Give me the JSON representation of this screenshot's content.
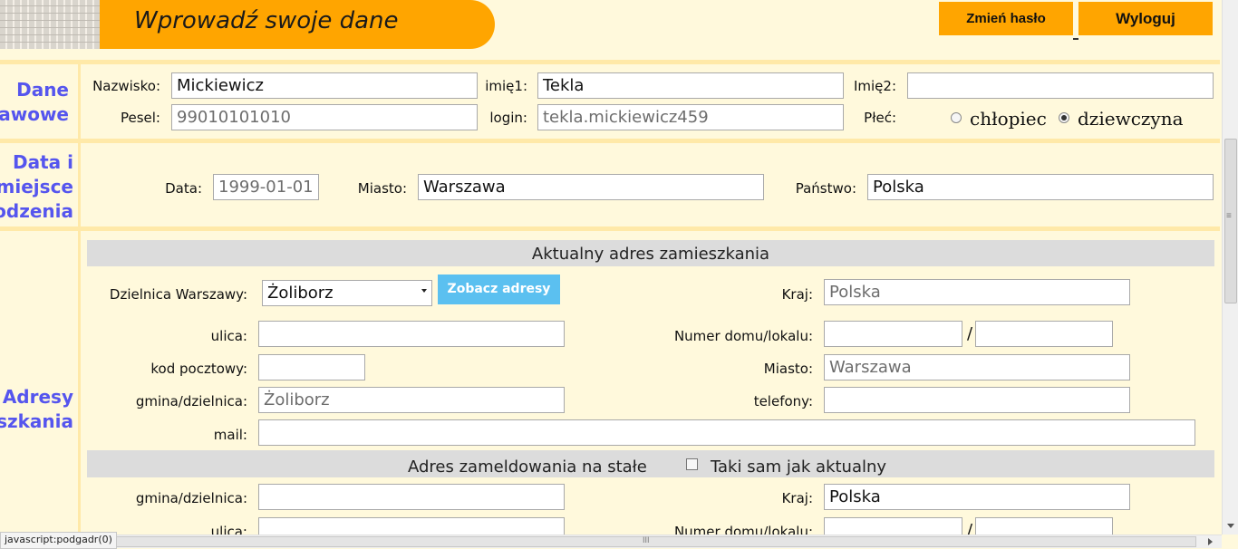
{
  "header": {
    "title": "Wprowadź swoje dane",
    "change_password": "Zmień hasło",
    "logout": "Wyloguj"
  },
  "sections": {
    "basic": "Dane\nawowe",
    "birth": "Data i\nmiejsce\nodzenia",
    "address": "Adresy\nszkania"
  },
  "basic": {
    "nazwisko_label": "Nazwisko:",
    "nazwisko_value": "Mickiewicz",
    "imie1_label": "imię1:",
    "imie1_value": "Tekla",
    "imie2_label": "Imię2:",
    "imie2_value": "",
    "pesel_label": "Pesel:",
    "pesel_value": "99010101010",
    "login_label": "login:",
    "login_value": "tekla.mickiewicz459",
    "plec_label": "Płeć:",
    "gender_options": [
      "chłopiec",
      "dziewczyna"
    ],
    "gender_selected": "dziewczyna"
  },
  "birth": {
    "data_label": "Data:",
    "data_value": "1999-01-01",
    "miasto_label": "Miasto:",
    "miasto_value": "Warszawa",
    "panstwo_label": "Państwo:",
    "panstwo_value": "Polska"
  },
  "current_address": {
    "header": "Aktualny adres zamieszkania",
    "dzielnica_label": "Dzielnica Warszawy:",
    "dzielnica_value": "Żoliborz",
    "zobacz_button": "Zobacz adresy",
    "kraj_label": "Kraj:",
    "kraj_value": "Polska",
    "ulica_label": "ulica:",
    "ulica_value": "",
    "numer_label": "Numer domu/lokalu:",
    "numer_value": "",
    "lokal_value": "",
    "slash": "/",
    "kod_label": "kod pocztowy:",
    "kod_value": "",
    "miasto_label": "Miasto:",
    "miasto_value": "Warszawa",
    "gmina_label": "gmina/dzielnica:",
    "gmina_value": "Żoliborz",
    "telefony_label": "telefony:",
    "telefony_value": "",
    "mail_label": "mail:",
    "mail_value": ""
  },
  "registered_address": {
    "header": "Adres zameldowania na stałe",
    "same_label": "Taki sam jak aktualny",
    "same_checked": false,
    "gmina_label": "gmina/dzielnica:",
    "gmina_value": "",
    "kraj_label": "Kraj:",
    "kraj_value": "Polska",
    "ulica_label": "ulica:",
    "numer_label": "Numer domu/lokalu:",
    "slash": "/"
  },
  "status_bar": {
    "text": "javascript:podgadr(0)"
  },
  "scrollbar": {
    "h_grip": "III",
    "v_grip": "≡"
  },
  "colors": {
    "background": "#fff9dc",
    "accent_orange": "#ffa500",
    "section_label": "#5555ee",
    "band_gray": "#dcdcdc",
    "separator": "#ffe9a8",
    "blue_button": "#5bc0f0"
  }
}
